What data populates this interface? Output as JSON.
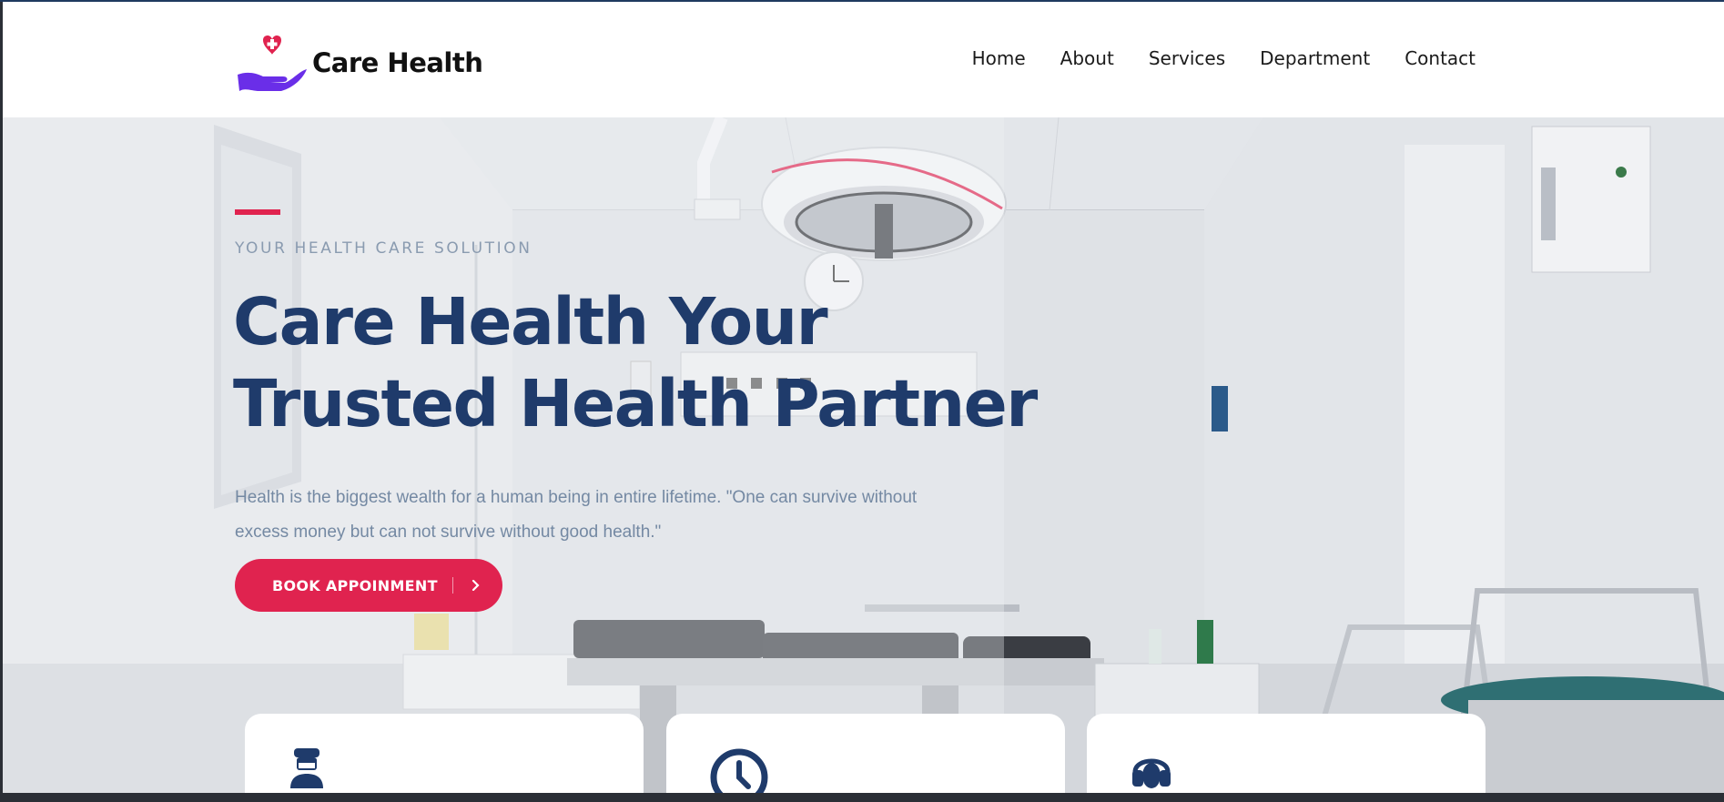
{
  "brand": {
    "name": "Care Health",
    "accent_color": "#e0234f",
    "logo_icon": "heart-hand-icon"
  },
  "nav": {
    "items": [
      {
        "label": "Home"
      },
      {
        "label": "About"
      },
      {
        "label": "Services"
      },
      {
        "label": "Department"
      },
      {
        "label": "Contact"
      }
    ]
  },
  "hero": {
    "eyebrow": "YOUR HEALTH CARE SOLUTION",
    "headline_line1": "Care Health Your",
    "headline_line2": "Trusted Health Partner",
    "lead": "Health is the biggest wealth for a human being in entire lifetime. \"One can survive without excess money but can not survive without good health.\"",
    "cta_label": "BOOK APPOINMENT",
    "cta_icon": "chevron-right-icon",
    "background": "operating-room-photo"
  },
  "feature_cards": [
    {
      "icon": "doctor-icon"
    },
    {
      "icon": "clock-icon"
    },
    {
      "icon": "headset-icon"
    }
  ],
  "colors": {
    "heading": "#1f3b6b",
    "text_muted": "#7489a3",
    "eyebrow": "#8a9bb0"
  }
}
